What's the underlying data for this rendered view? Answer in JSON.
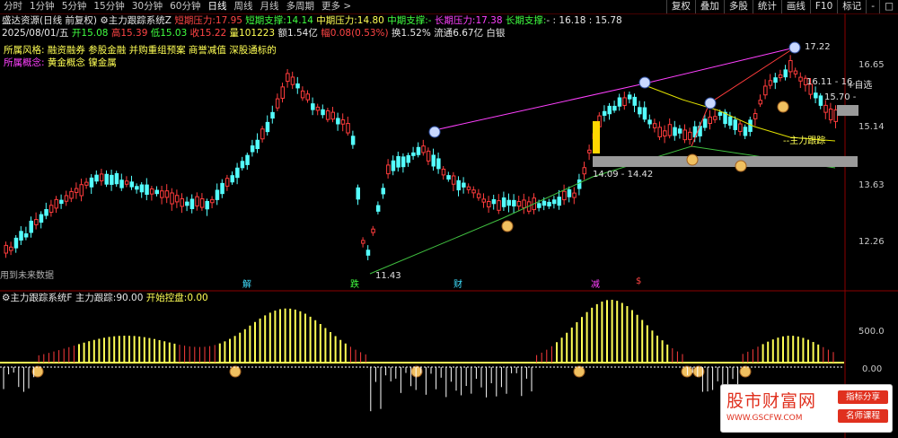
{
  "toolbar": {
    "periods": [
      "分时",
      "1分钟",
      "5分钟",
      "15分钟",
      "30分钟",
      "60分钟",
      "日线",
      "周线",
      "月线",
      "多周期",
      "更多 >"
    ],
    "active_period": "日线",
    "buttons": [
      "复权",
      "叠加",
      "多股",
      "统计",
      "画线",
      "F10",
      "标记",
      "-",
      "□"
    ]
  },
  "header": {
    "stock": "盛达资源(日线 前复权)",
    "indicator": "主力跟踪系统Z",
    "short_pressure_label": "短期压力:",
    "short_pressure": "17.95",
    "short_support_label": "短期支撑:",
    "short_support": "14.14",
    "mid_pressure_label": "中期压力:",
    "mid_pressure": "14.80",
    "mid_support_label": "中期支撑:",
    "mid_support": "-",
    "long_pressure_label": "长期压力:",
    "long_pressure": "17.38",
    "long_support_label": "长期支撑:",
    "long_support": "- : 16.18 : 15.78"
  },
  "quote": {
    "date": "2025/08/01/五",
    "open_label": "开",
    "open": "15.08",
    "high_label": "高",
    "high": "15.39",
    "low_label": "低",
    "low": "15.03",
    "close_label": "收",
    "close": "15.22",
    "volume_label": "量",
    "volume": "101223",
    "amount_label": "额",
    "amount": "1.54亿",
    "change_label": "幅",
    "change": "0.08(0.53%)",
    "turnover_label": "换",
    "turnover": "1.52%",
    "float_label": "流通",
    "float": "6.67亿",
    "sector": "白银"
  },
  "concepts": {
    "style_label": "所属风格:",
    "style": "融资融券 参股金融 并购重组预案 商誉减值 深股通标的",
    "concept_label": "所属概念:",
    "concept": "黄金概念 镍金属"
  },
  "price_axis": [
    "16.65",
    "15.14",
    "13.63",
    "12.26"
  ],
  "annotations": {
    "future_data": "用到未来数据",
    "low_point": "11.43",
    "high_point": "17.22",
    "range": "14.09 - 14.42",
    "right_a": "16.11 - 16.",
    "right_b": "15.70 -",
    "auto_return": "+自选",
    "main_track": "--主力跟踪",
    "event_jie": "解",
    "event_die": "跌",
    "event_cai": "财",
    "event_jian": "减",
    "event_s": "$"
  },
  "lower": {
    "indicator": "主力跟踪系统F",
    "track_label": "主力跟踪:",
    "track": "90.00",
    "start_label": "开始控盘:",
    "start": "0.00",
    "axis": [
      "500.0",
      "0.00"
    ]
  },
  "badge": {
    "title": "股市财富网",
    "url": "WWW.GSCFW.COM",
    "tag1": "指标分享",
    "tag2": "名师课程"
  },
  "colors": {
    "up": "#ff3c3c",
    "down": "#54ffff",
    "ma_yellow": "#e0e000",
    "trend_magenta": "#ff40ff",
    "trend_green": "#40c040",
    "bg": "#000000"
  }
}
